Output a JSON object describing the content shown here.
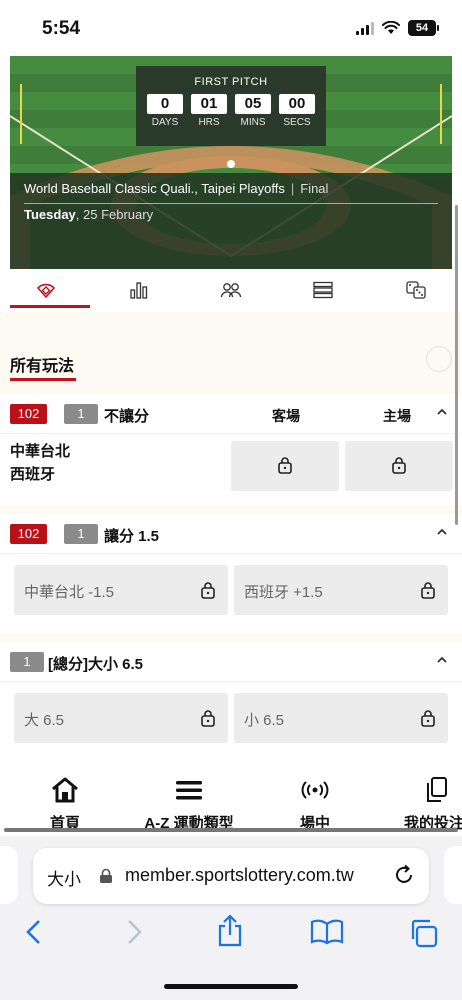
{
  "status_bar": {
    "time": "5:54",
    "battery": "54",
    "icons": [
      "signal-icon",
      "wifi-icon",
      "battery-icon"
    ]
  },
  "hero": {
    "countdown_title": "FIRST PITCH",
    "countdown": [
      {
        "value": "0",
        "label": "DAYS"
      },
      {
        "value": "01",
        "label": "HRS"
      },
      {
        "value": "05",
        "label": "MINS"
      },
      {
        "value": "00",
        "label": "SECS"
      }
    ],
    "competition": "World Baseball Classic Quali., Taipei Playoffs",
    "match_status": "Final",
    "day": "Tuesday",
    "date": ", 25 February"
  },
  "tabs": [
    {
      "icon": "baseball-field-icon",
      "active": true
    },
    {
      "icon": "bar-chart-icon",
      "active": false
    },
    {
      "icon": "players-icon",
      "active": false
    },
    {
      "icon": "list-icon",
      "active": false
    },
    {
      "icon": "dice-icon",
      "active": false
    }
  ],
  "filter": {
    "title": "所有玩法"
  },
  "markets": [
    {
      "badge_red": "102",
      "badge_gray": "1",
      "name": "不讓分",
      "col_away": "客場",
      "col_home": "主場",
      "team1": "中華台北",
      "team2": "西班牙"
    },
    {
      "badge_red": "102",
      "badge_gray": "1",
      "name": "讓分 1.5",
      "left": "中華台北 -1.5",
      "right": "西班牙 +1.5"
    },
    {
      "badge_gray": "1",
      "name": "[總分]大小 6.5",
      "left": "大 6.5",
      "right": "小 6.5"
    }
  ],
  "bottom_nav": [
    {
      "label": "首頁",
      "icon": "home-icon"
    },
    {
      "label": "A-Z 運動類型",
      "icon": "menu-icon"
    },
    {
      "label": "場中",
      "icon": "live-icon"
    },
    {
      "label": "我的投注",
      "icon": "bets-icon"
    }
  ],
  "browser": {
    "aa": "大小",
    "url": "member.sportslottery.com.tw"
  },
  "colors": {
    "accent": "#c0121b",
    "field_green": "#3f7d3a"
  }
}
